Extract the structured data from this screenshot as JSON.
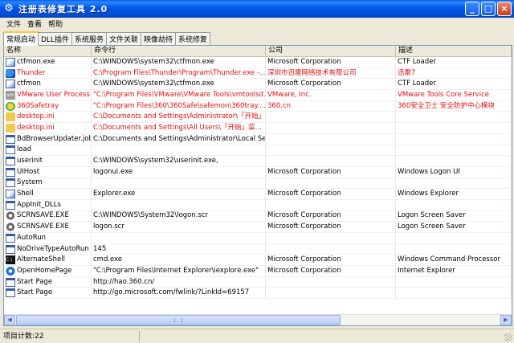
{
  "window": {
    "title": "注册表修复工具 2.0",
    "minimize_label": "_",
    "maximize_label": "□",
    "close_label": "×"
  },
  "menu": [
    "文件",
    "查看",
    "帮助"
  ],
  "tabs": [
    "常规启动",
    "DLL插件",
    "系统服务",
    "文件关联",
    "映像劫持",
    "系统修复"
  ],
  "columns": [
    "名称",
    "命令行",
    "公司",
    "描述"
  ],
  "rows": [
    {
      "icon": "exe",
      "name": "ctfmon.exe",
      "cmd": "C:\\WINDOWS\\system32\\ctfmon.exe",
      "company": "Microsoft Corporation",
      "desc": "CTF Loader",
      "red": false
    },
    {
      "icon": "bird",
      "name": "Thunder",
      "cmd": "C:\\Program Files\\Thunder\\Program\\Thunder.exe -...",
      "company": "深圳市迅雷网络技术有限公司",
      "desc": "迅雷7",
      "red": true
    },
    {
      "icon": "exe",
      "name": "ctfmon",
      "cmd": "C:\\WINDOWS\\system32\\ctfmon.exe",
      "company": "Microsoft Corporation",
      "desc": "CTF Loader",
      "red": false
    },
    {
      "icon": "vm",
      "name": "VMware User Process",
      "cmd": "\"C:\\Program Files\\VMware\\VMware Tools\\vmtoolsd....",
      "company": "VMware, Inc.",
      "desc": "VMware Tools Core Service",
      "red": true
    },
    {
      "icon": "shield",
      "name": "360Safetray",
      "cmd": "\"C:\\Program Files\\360\\360Safe\\safemon\\360tray....",
      "company": "360.cn",
      "desc": "360安全卫士 安全防护中心模块",
      "red": true
    },
    {
      "icon": "folder",
      "name": "desktop.ini",
      "cmd": "C:\\Documents and Settings\\Administrator\\「开始」...",
      "company": "",
      "desc": "",
      "red": true
    },
    {
      "icon": "folder",
      "name": "desktop.ini",
      "cmd": "C:\\Documents and Settings\\All Users\\「开始」菜...",
      "company": "",
      "desc": "",
      "red": true
    },
    {
      "icon": "blank",
      "name": "BdBrowserUpdater.job",
      "cmd": "C:\\Documents and Settings\\Administrator\\Local Se...",
      "company": "",
      "desc": "",
      "red": false
    },
    {
      "icon": "blank",
      "name": "load",
      "cmd": "",
      "company": "",
      "desc": "",
      "red": false
    },
    {
      "icon": "blank",
      "name": "userinit",
      "cmd": "C:\\WINDOWS\\system32\\userinit.exe,",
      "company": "",
      "desc": "",
      "red": false
    },
    {
      "icon": "blank",
      "name": "UIHost",
      "cmd": "logonui.exe",
      "company": "Microsoft Corporation",
      "desc": "Windows Logon UI",
      "red": false
    },
    {
      "icon": "blank",
      "name": "System",
      "cmd": "",
      "company": "",
      "desc": "",
      "red": false
    },
    {
      "icon": "exe",
      "name": "Shell",
      "cmd": "Explorer.exe",
      "company": "Microsoft Corporation",
      "desc": "Windows Explorer",
      "red": false
    },
    {
      "icon": "blank",
      "name": "AppInit_DLLs",
      "cmd": "",
      "company": "",
      "desc": "",
      "red": false
    },
    {
      "icon": "gear",
      "name": "SCRNSAVE.EXE",
      "cmd": "C:\\WINDOWS\\System32\\logon.scr",
      "company": "Microsoft Corporation",
      "desc": "Logon Screen Saver",
      "red": false
    },
    {
      "icon": "gear",
      "name": "SCRNSAVE.EXE",
      "cmd": "logon.scr",
      "company": "Microsoft Corporation",
      "desc": "Logon Screen Saver",
      "red": false
    },
    {
      "icon": "blank",
      "name": "AutoRun",
      "cmd": "",
      "company": "",
      "desc": "",
      "red": false
    },
    {
      "icon": "blank",
      "name": "NoDriveTypeAutoRun",
      "cmd": "145",
      "company": "",
      "desc": "",
      "red": false
    },
    {
      "icon": "cmd",
      "name": "AlternateShell",
      "cmd": "cmd.exe",
      "company": "Microsoft Corporation",
      "desc": "Windows Command Processor",
      "red": false
    },
    {
      "icon": "ie",
      "name": "OpenHomePage",
      "cmd": "\"C:\\Program Files\\Internet Explorer\\iexplore.exe\"",
      "company": "Microsoft Corporation",
      "desc": "Internet Explorer",
      "red": false
    },
    {
      "icon": "blank",
      "name": "Start Page",
      "cmd": "http://hao.360.cn/",
      "company": "",
      "desc": "",
      "red": false
    },
    {
      "icon": "blank",
      "name": "Start Page",
      "cmd": "http://go.microsoft.com/fwlink/?LinkId=69157",
      "company": "",
      "desc": "",
      "red": false
    }
  ],
  "status": {
    "item_count": "项目计数:22"
  },
  "colors": {
    "suspicious_text": "#E01010",
    "titlebar": "#0058E6"
  }
}
